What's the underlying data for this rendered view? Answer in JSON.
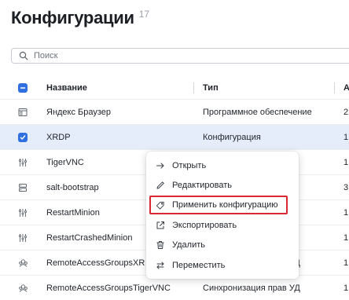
{
  "header": {
    "title": "Конфигурации",
    "count": "17"
  },
  "search": {
    "placeholder": "Поиск"
  },
  "table": {
    "columns": [
      "Название",
      "Тип",
      "А"
    ],
    "rows": [
      {
        "icon": "browser-icon",
        "name": "Яндекс Браузер",
        "type": "Программное обеспечение",
        "extra": "2",
        "selected": false
      },
      {
        "icon": "checkbox-checked-icon",
        "name": "XRDP",
        "type": "Конфигурация",
        "extra": "1",
        "selected": true
      },
      {
        "icon": "script-icon",
        "name": "TigerVNC",
        "type": "",
        "extra": "1",
        "selected": false
      },
      {
        "icon": "server-icon",
        "name": "salt-bootstrap",
        "type": "",
        "extra": "3",
        "selected": false
      },
      {
        "icon": "script-icon",
        "name": "RestartMinion",
        "type": "",
        "extra": "1",
        "selected": false
      },
      {
        "icon": "script-icon",
        "name": "RestartCrashedMinion",
        "type": "",
        "extra": "1",
        "selected": false
      },
      {
        "icon": "group-access-icon",
        "name": "RemoteAccessGroupsXR",
        "type": "Синхронизация прав УД",
        "extra": "1",
        "selected": false
      },
      {
        "icon": "group-access-icon",
        "name": "RemoteAccessGroupsTigerVNC",
        "type": "Синхронизация прав УД",
        "extra": "1",
        "selected": false
      }
    ]
  },
  "context_menu": {
    "items": [
      {
        "icon": "arrow-right-icon",
        "label": "Открыть"
      },
      {
        "icon": "pencil-icon",
        "label": "Редактировать"
      },
      {
        "icon": "tag-icon",
        "label": "Применить конфигурацию",
        "highlighted": true
      },
      {
        "icon": "export-icon",
        "label": "Экспортировать"
      },
      {
        "icon": "trash-icon",
        "label": "Удалить"
      },
      {
        "icon": "move-icon",
        "label": "Переместить"
      }
    ]
  },
  "colors": {
    "accent": "#2f6fe0",
    "selected_row": "#e5edfb",
    "highlight_border": "#d9282f"
  }
}
